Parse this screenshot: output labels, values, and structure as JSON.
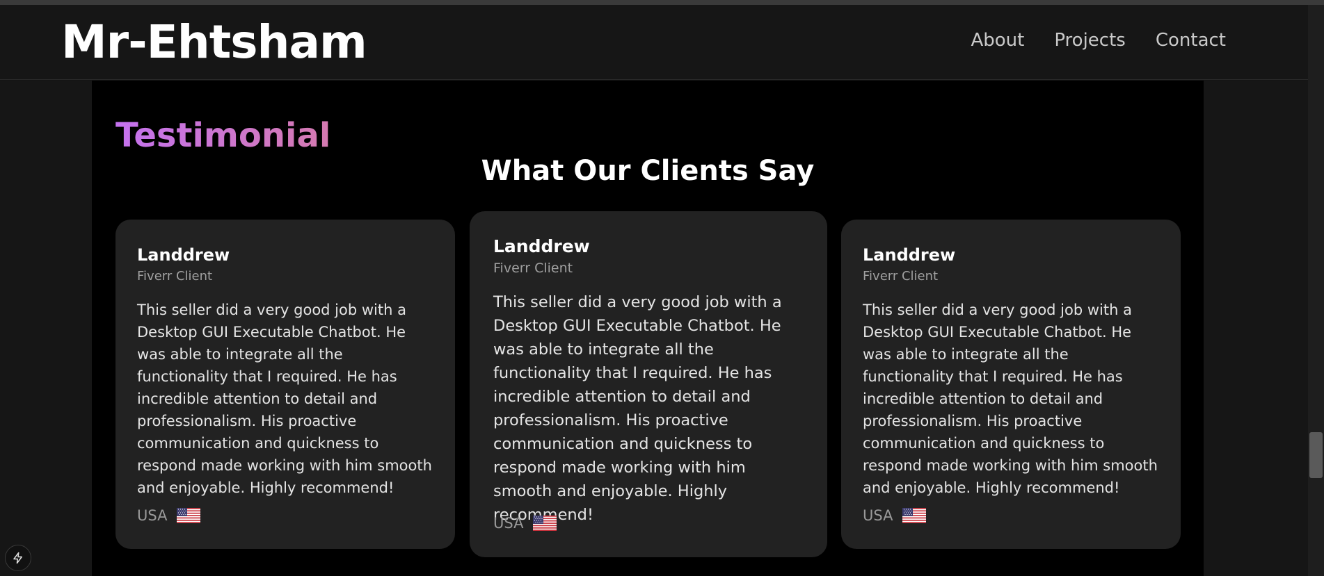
{
  "header": {
    "logo": "Mr-Ehtsham",
    "nav": [
      "About",
      "Projects",
      "Contact"
    ]
  },
  "section": {
    "eyebrow": "Testimonial",
    "title": "What Our Clients Say"
  },
  "testimonials": [
    {
      "name": "Landdrew",
      "role": "Fiverr Client",
      "quote": "This seller did a very good job with a Desktop GUI Executable Chatbot. He was able to integrate all the functionality that I required. He has incredible attention to detail and professionalism. His proactive communication and quickness to respond made working with him smooth and enjoyable. Highly recommend!",
      "country": "USA",
      "flag_icon": "us-flag-icon"
    },
    {
      "name": "Landdrew",
      "role": "Fiverr Client",
      "quote": "This seller did a very good job with a Desktop GUI Executable Chatbot. He was able to integrate all the functionality that I required. He has incredible attention to detail and professionalism. His proactive communication and quickness to respond made working with him smooth and enjoyable. Highly recommend!",
      "country": "USA",
      "flag_icon": "us-flag-icon"
    },
    {
      "name": "Landdrew",
      "role": "Fiverr Client",
      "quote": "This seller did a very good job with a Desktop GUI Executable Chatbot. He was able to integrate all the functionality that I required. He has incredible attention to detail and professionalism. His proactive communication and quickness to respond made working with him smooth and enjoyable. Highly recommend!",
      "country": "USA",
      "flag_icon": "us-flag-icon"
    }
  ],
  "colors": {
    "background": "#000000",
    "card": "#222222",
    "accent_gradient_start": "#c472ef",
    "accent_gradient_end": "#d57ab0"
  },
  "floating_button_icon": "lightning-icon"
}
